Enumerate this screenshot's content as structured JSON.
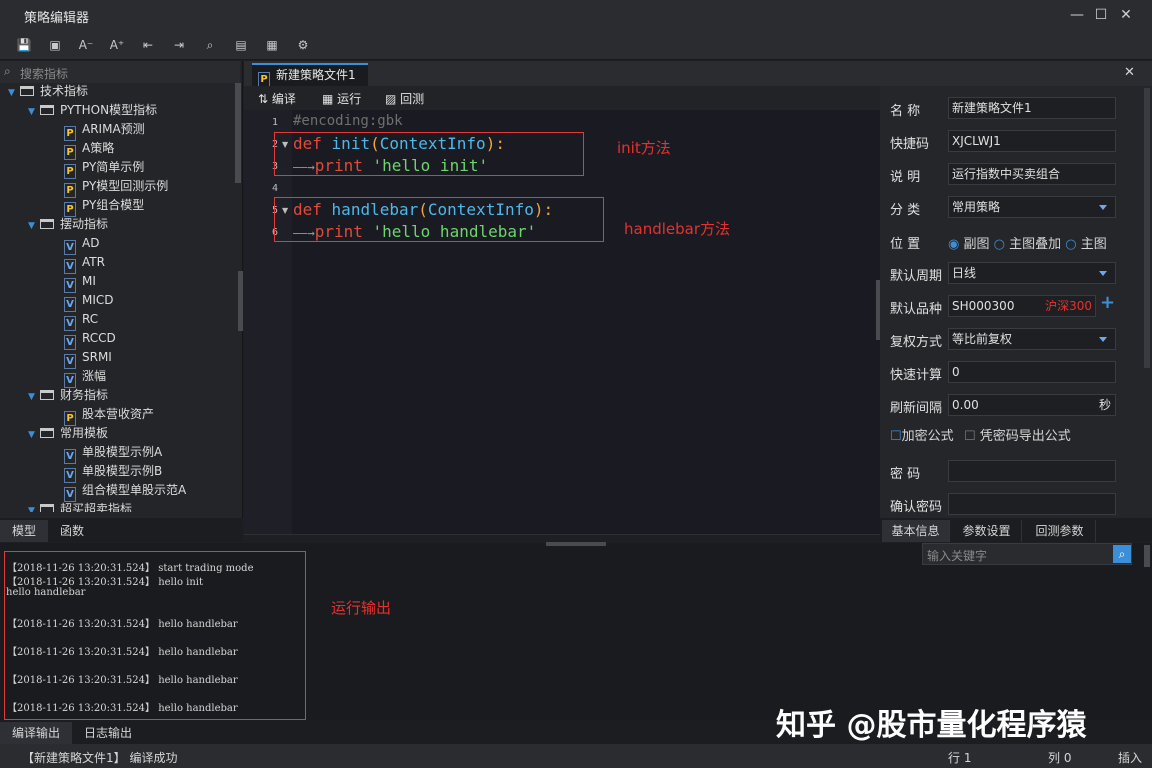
{
  "window": {
    "title": "策略编辑器",
    "minimize": "—",
    "maximize": "☐",
    "close": "✕"
  },
  "toolbar": {
    "icons": [
      "save-icon",
      "save-all-icon",
      "font-decrease-icon",
      "font-increase-icon",
      "import-icon",
      "export-icon",
      "find-icon",
      "doc-icon",
      "doc-list-icon",
      "settings-icon"
    ],
    "glyphs": [
      "💾",
      "▣",
      "A⁻",
      "A⁺",
      "⇤",
      "⇥",
      "⌕",
      "▤",
      "▦",
      "⚙"
    ]
  },
  "left": {
    "search_placeholder": "搜索指标",
    "tree": [
      {
        "level": 0,
        "type": "folder",
        "label": "技术指标"
      },
      {
        "level": 1,
        "type": "folder",
        "label": "PYTHON模型指标"
      },
      {
        "level": 2,
        "type": "P",
        "label": "ARIMA预测"
      },
      {
        "level": 2,
        "type": "P",
        "label": "A策略"
      },
      {
        "level": 2,
        "type": "P",
        "label": "PY简单示例"
      },
      {
        "level": 2,
        "type": "P",
        "label": "PY模型回测示例"
      },
      {
        "level": 2,
        "type": "P",
        "label": "PY组合模型"
      },
      {
        "level": 1,
        "type": "folder",
        "label": "摆动指标"
      },
      {
        "level": 2,
        "type": "V",
        "label": "AD"
      },
      {
        "level": 2,
        "type": "V",
        "label": "ATR"
      },
      {
        "level": 2,
        "type": "V",
        "label": "MI"
      },
      {
        "level": 2,
        "type": "V",
        "label": "MICD"
      },
      {
        "level": 2,
        "type": "V",
        "label": "RC"
      },
      {
        "level": 2,
        "type": "V",
        "label": "RCCD"
      },
      {
        "level": 2,
        "type": "V",
        "label": "SRMI"
      },
      {
        "level": 2,
        "type": "V",
        "label": "涨幅"
      },
      {
        "level": 1,
        "type": "folder",
        "label": "财务指标"
      },
      {
        "level": 2,
        "type": "P",
        "label": "股本营收资产"
      },
      {
        "level": 1,
        "type": "folder",
        "label": "常用模板"
      },
      {
        "level": 2,
        "type": "V",
        "label": "单股模型示例A"
      },
      {
        "level": 2,
        "type": "V",
        "label": "单股模型示例B"
      },
      {
        "level": 2,
        "type": "V",
        "label": "组合模型单股示范A"
      },
      {
        "level": 1,
        "type": "folder",
        "label": "超买超卖指标"
      }
    ],
    "tabs": [
      "模型",
      "函数"
    ]
  },
  "editor": {
    "file_tab": "新建策略文件1",
    "close": "✕",
    "tools": [
      {
        "icon": "compile-icon",
        "label": "编译"
      },
      {
        "icon": "run-icon",
        "label": "运行"
      },
      {
        "icon": "backtest-icon",
        "label": "回测"
      }
    ],
    "line_numbers": [
      "1",
      "2",
      "3",
      "4",
      "5",
      "6"
    ],
    "code": {
      "l1": "#encoding:gbk",
      "def": "def",
      "init": "init",
      "ctx": "ContextInfo",
      "arrow": "——→",
      "print": "print",
      "hello_init": "'hello init'",
      "handlebar": "handlebar",
      "hello_handlebar": "'hello handlebar'",
      "lp": "(",
      "rp": "):"
    },
    "annotations": {
      "init": "init方法",
      "handlebar": "handlebar方法",
      "output": "运行输出"
    }
  },
  "props": {
    "name_label": "名  称",
    "name_value": "新建策略文件1",
    "shortcut_label": "快捷码",
    "shortcut_value": "XJCLWJ1",
    "desc_label": "说  明",
    "desc_value": "运行指数中买卖组合",
    "category_label": "分  类",
    "category_value": "常用策略",
    "position_label": "位  置",
    "position_options": [
      "副图",
      "主图叠加",
      "主图"
    ],
    "period_label": "默认周期",
    "period_value": "日线",
    "symbol_label": "默认品种",
    "symbol_value": "SH000300",
    "symbol_tag": "沪深300",
    "symbol_add": "+",
    "adjust_label": "复权方式",
    "adjust_value": "等比前复权",
    "fastcalc_label": "快速计算",
    "fastcalc_value": "0",
    "refresh_label": "刷新间隔",
    "refresh_value": "0.00",
    "refresh_unit": "秒",
    "encrypt_label": "加密公式",
    "export_label": "凭密码导出公式",
    "pwd_label": "密  码",
    "pwd2_label": "确认密码",
    "tabs": [
      "基本信息",
      "参数设置",
      "回测参数"
    ]
  },
  "output": {
    "search_placeholder": "输入关键字",
    "lines": [
      "【2018-11-26 13:20:31.524】 start trading mode",
      "【2018-11-26 13:20:31.524】 hello init",
      "hello handlebar",
      "",
      "【2018-11-26 13:20:31.524】 hello handlebar",
      "",
      "【2018-11-26 13:20:31.524】 hello handlebar",
      "",
      "【2018-11-26 13:20:31.524】 hello handlebar",
      "",
      "【2018-11-26 13:20:31.524】 hello handlebar"
    ],
    "tabs": [
      "编译输出",
      "日志输出"
    ]
  },
  "status": {
    "message": "【新建策略文件1】 编译成功",
    "row_label": "行 1",
    "col_label": "列 0",
    "mode": "插入"
  },
  "watermark": "知乎 @股市量化程序猿",
  "colors": {
    "accent": "#3b8fd9",
    "annotation": "#e5322f",
    "keyword": "#e24a3a",
    "function": "#4fb7e8",
    "string": "#6ed46e"
  }
}
